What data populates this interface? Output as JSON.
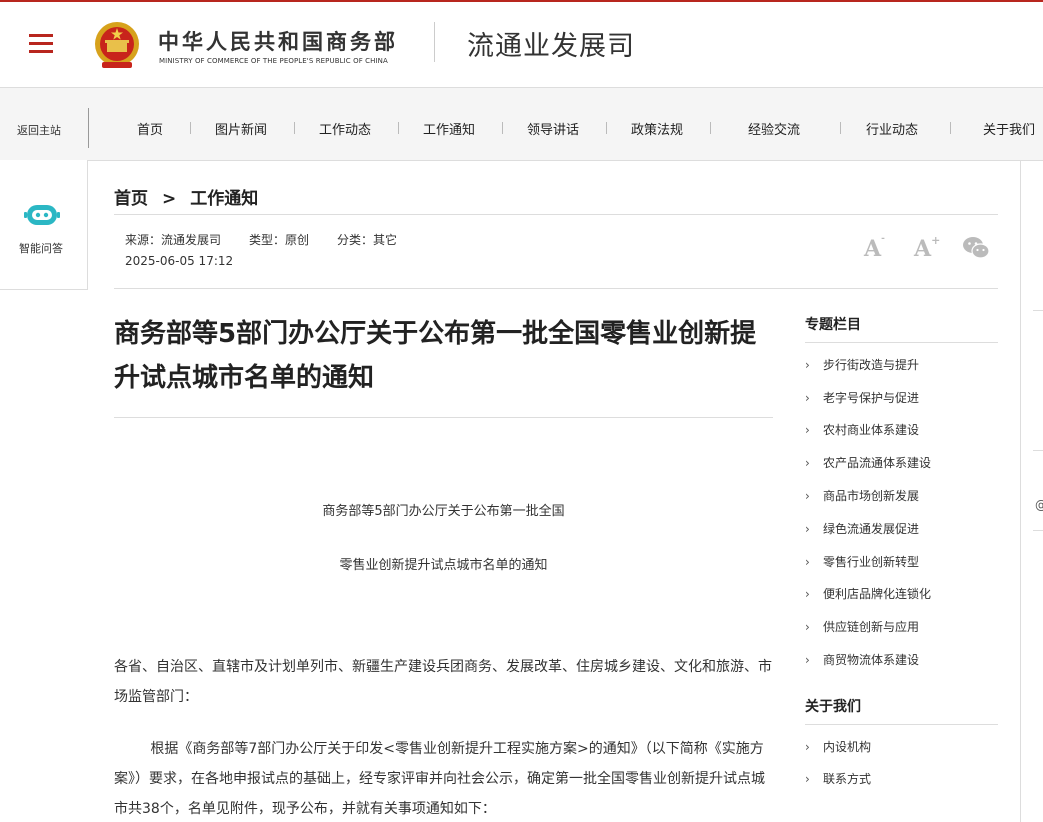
{
  "header": {
    "ministry_cn": "中华人民共和国商务部",
    "ministry_en": "MINISTRY OF COMMERCE OF THE PEOPLE'S REPUBLIC OF CHINA",
    "dept_name": "流通业发展司"
  },
  "nav": {
    "back_home": "返回主站",
    "items": [
      "首页",
      "图片新闻",
      "工作动态",
      "工作通知",
      "领导讲话",
      "政策法规",
      "经验交流",
      "行业动态",
      "关于我们"
    ]
  },
  "left_panel": {
    "label": "智能问答"
  },
  "breadcrumb": {
    "home": "首页",
    "sep": ">",
    "current": "工作通知"
  },
  "meta": {
    "source": "来源：流通发展司",
    "type": "类型：原创",
    "category": "分类：其它",
    "date": "2025-06-05 17:12",
    "font_small": "A",
    "font_large": "A",
    "font_plus": "+"
  },
  "article": {
    "title": "商务部等5部门办公厅关于公布第一批全国零售业创新提升试点城市名单的通知",
    "sub_title_1": "商务部等5部门办公厅关于公布第一批全国",
    "sub_title_2": "零售业创新提升试点城市名单的通知",
    "para1": "各省、自治区、直辖市及计划单列市、新疆生产建设兵团商务、发展改革、住房城乡建设、文化和旅游、市场监管部门：",
    "para2": "根据《商务部等7部门办公厅关于印发<零售业创新提升工程实施方案>的通知》（以下简称《实施方案》）要求，在各地申报试点的基础上，经专家评审并向社会公示，确定第一批全国零售业创新提升试点城市共38个，名单见附件，现予公布，并就有关事项通知如下："
  },
  "sidebar": {
    "topics_title": "专题栏目",
    "topics": [
      "步行街改造与提升",
      "老字号保护与促进",
      "农村商业体系建设",
      "农产品流通体系建设",
      "商品市场创新发展",
      "绿色流通发展促进",
      "零售行业创新转型",
      "便利店品牌化连锁化",
      "供应链创新与应用",
      "商贸物流体系建设"
    ],
    "about_title": "关于我们",
    "about": [
      "内设机构",
      "联系方式"
    ],
    "chevron": "›"
  },
  "right_edge": {
    "mark": "@"
  },
  "colors": {
    "brand_red": "#b8261e",
    "robot_teal": "#2bb7c4"
  }
}
